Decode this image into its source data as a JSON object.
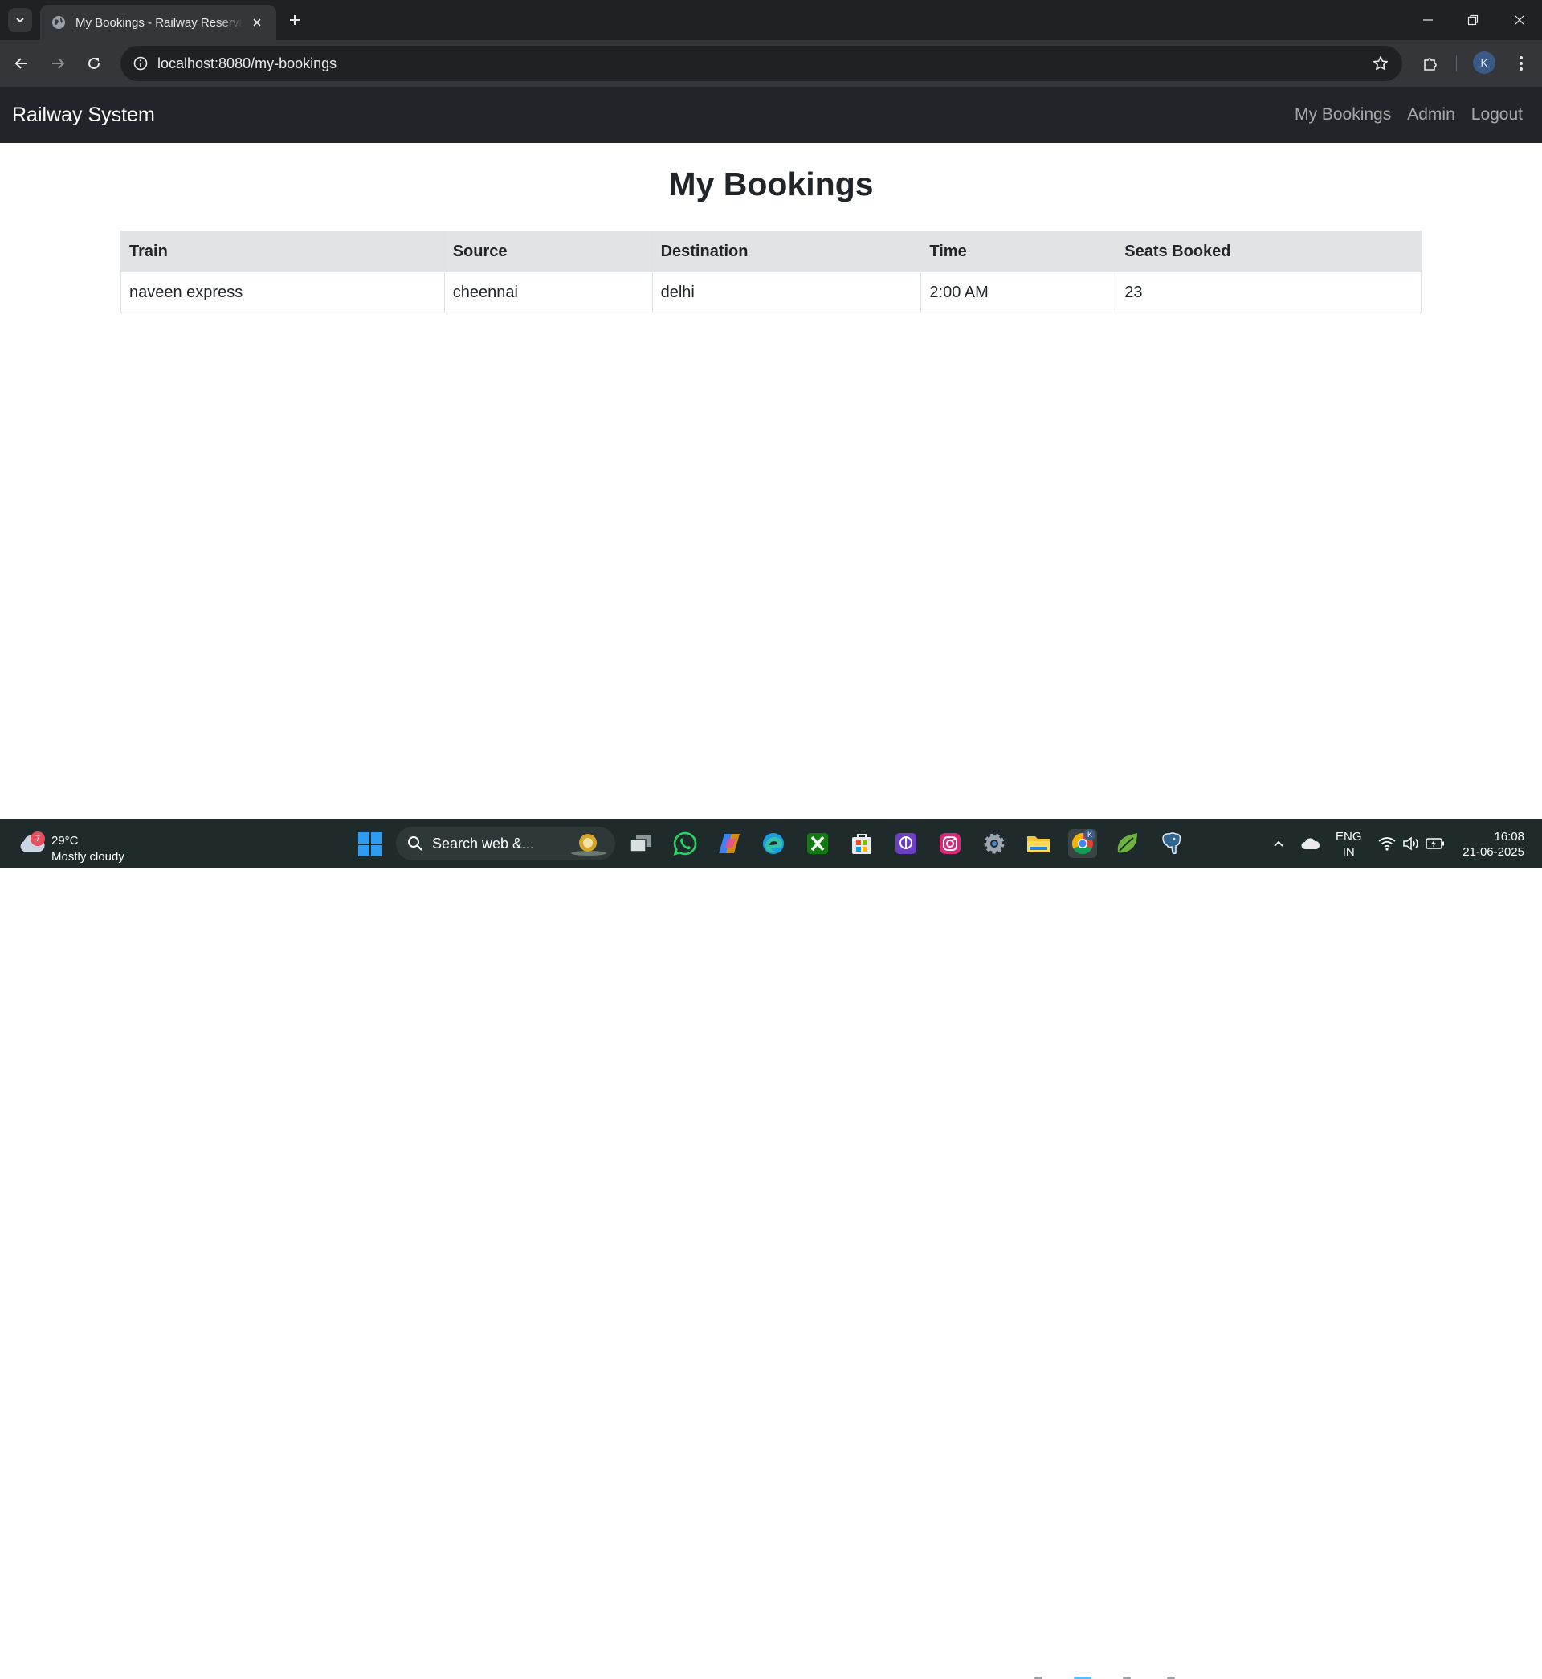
{
  "browser": {
    "tab_title": "My Bookings - Railway Reservation",
    "url": "localhost:8080/my-bookings",
    "profile_initial": "K"
  },
  "navbar": {
    "brand": "Railway System",
    "links": [
      "My Bookings",
      "Admin",
      "Logout"
    ]
  },
  "page": {
    "title": "My Bookings"
  },
  "table": {
    "headers": [
      "Train",
      "Source",
      "Destination",
      "Time",
      "Seats Booked"
    ],
    "rows": [
      [
        "naveen express",
        "cheennai",
        "delhi",
        "2:00 AM",
        "23"
      ]
    ]
  },
  "taskbar": {
    "weather_badge": "7",
    "temperature": "29°C",
    "condition": "Mostly cloudy",
    "search_text": "Search web &...",
    "language": "ENG",
    "region": "IN",
    "time": "16:08",
    "date": "21-06-2025",
    "chrome_badge": "K"
  },
  "colors": {
    "navbar_bg": "#212529",
    "table_header_bg": "#e2e3e5",
    "chrome_dark": "#202124",
    "taskbar_bg": "#1f2a2a"
  }
}
